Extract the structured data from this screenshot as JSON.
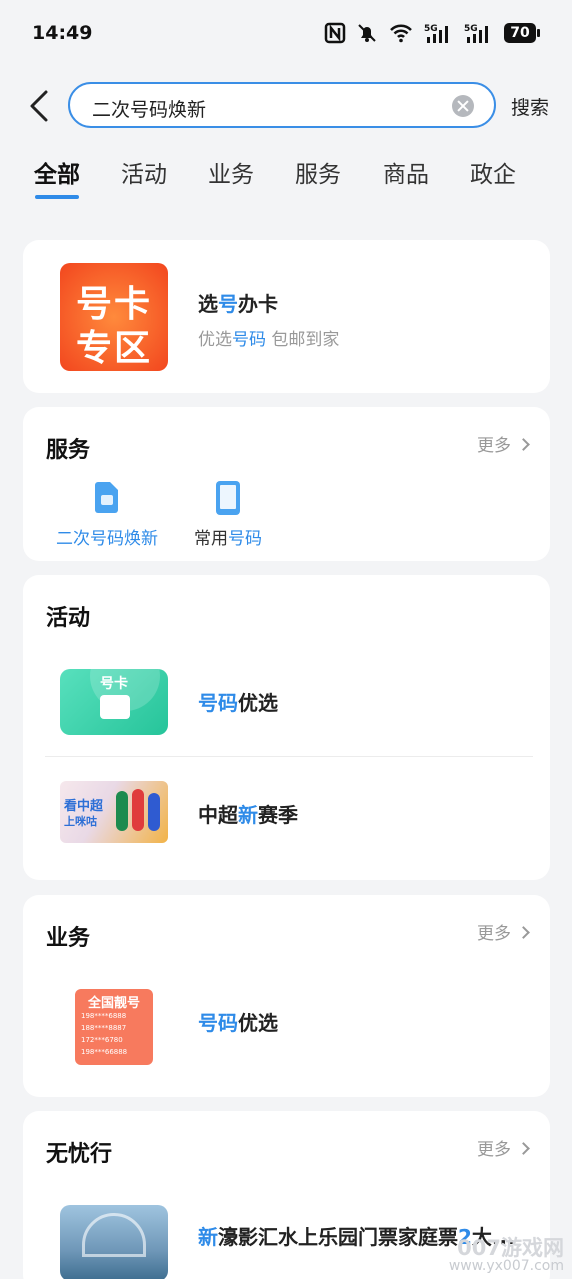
{
  "status_bar": {
    "time": "14:49",
    "battery": "70"
  },
  "search": {
    "query": "二次号码焕新",
    "button_label": "搜索"
  },
  "tabs": [
    {
      "label": "全部"
    },
    {
      "label": "活动"
    },
    {
      "label": "业务"
    },
    {
      "label": "服务"
    },
    {
      "label": "商品"
    },
    {
      "label": "政企"
    }
  ],
  "card_sim": {
    "thumb_text_1": "号卡",
    "thumb_text_2": "专区",
    "title_pre": "选",
    "title_hl": "号",
    "title_post": "办卡",
    "sub_pre": "优选",
    "sub_hl": "号码",
    "sub_post": " 包邮到家"
  },
  "services": {
    "title": "服务",
    "more": "更多",
    "items": [
      {
        "label_pre": "",
        "label_hl": "二次号码焕新",
        "label_post": ""
      },
      {
        "label_pre": "常用",
        "label_hl": "号码",
        "label_post": ""
      }
    ]
  },
  "activities": {
    "title": "活动",
    "items": [
      {
        "pre": "",
        "hl": "号码",
        "post": "优选",
        "thumb_text": "号卡"
      },
      {
        "pre": "中超",
        "hl": "新",
        "post": "赛季",
        "thumb_text_1": "看中超",
        "thumb_text_2": "上咪咕"
      }
    ]
  },
  "business": {
    "title": "业务",
    "more": "更多",
    "item": {
      "pre": "",
      "hl": "号码",
      "post": "优选",
      "thumb_title": "全国靓号",
      "thumb_rows": [
        "198****6888",
        "188****8887",
        "172***6780",
        "198***66888"
      ]
    }
  },
  "travel": {
    "title": "无忧行",
    "more": "更多",
    "item": {
      "hl1": "新",
      "mid": "濠影汇水上乐园门票家庭票",
      "hl2": "2",
      "post": "大..."
    }
  },
  "watermark": {
    "brand": "007游戏网",
    "url": "www.yx007.com"
  }
}
